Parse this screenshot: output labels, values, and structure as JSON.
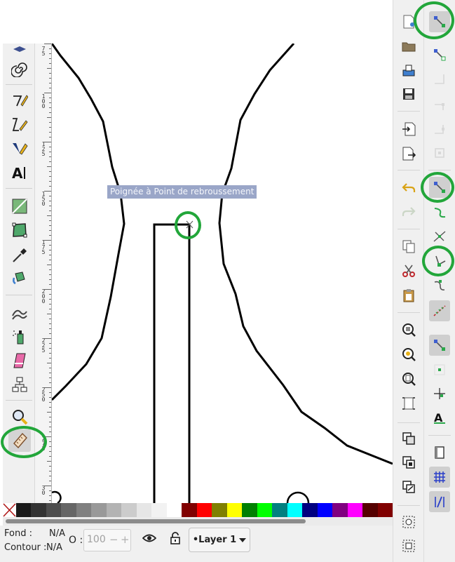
{
  "tooltip": "Poignée à Point de rebroussement",
  "status": {
    "fill_label": "Fond :",
    "fill_value": "N/A",
    "stroke_label": "Contour :",
    "stroke_value": "N/A",
    "opacity_label": "O :",
    "opacity_value": "100",
    "opacity_minus": "−",
    "opacity_plus": "+",
    "layer": "•Layer 1"
  },
  "ruler_labels": [
    {
      "text": "7\n5"
    },
    {
      "text": "1\n0\n0"
    },
    {
      "text": "1\n2\n5"
    },
    {
      "text": "1\n5\n0"
    },
    {
      "text": "1\n7\n5"
    },
    {
      "text": "2\n0\n0"
    },
    {
      "text": "2\n2\n5"
    },
    {
      "text": "2\n5\n0"
    },
    {
      "text": "2\n7\n5"
    },
    {
      "text": "3\n0"
    }
  ],
  "palette": [
    "#1a1a1a",
    "#333333",
    "#4d4d4d",
    "#666666",
    "#808080",
    "#999999",
    "#b3b3b3",
    "#cccccc",
    "#e6e6e6",
    "#f2f2f2",
    "#ffffff",
    "#800000",
    "#ff0000",
    "#808000",
    "#ffff00",
    "#008000",
    "#00ff00",
    "#008080",
    "#00ffff",
    "#000080",
    "#0000ff",
    "#800080",
    "#ff00ff",
    "#550000",
    "#800000"
  ],
  "accent_ring": "#22a63a"
}
